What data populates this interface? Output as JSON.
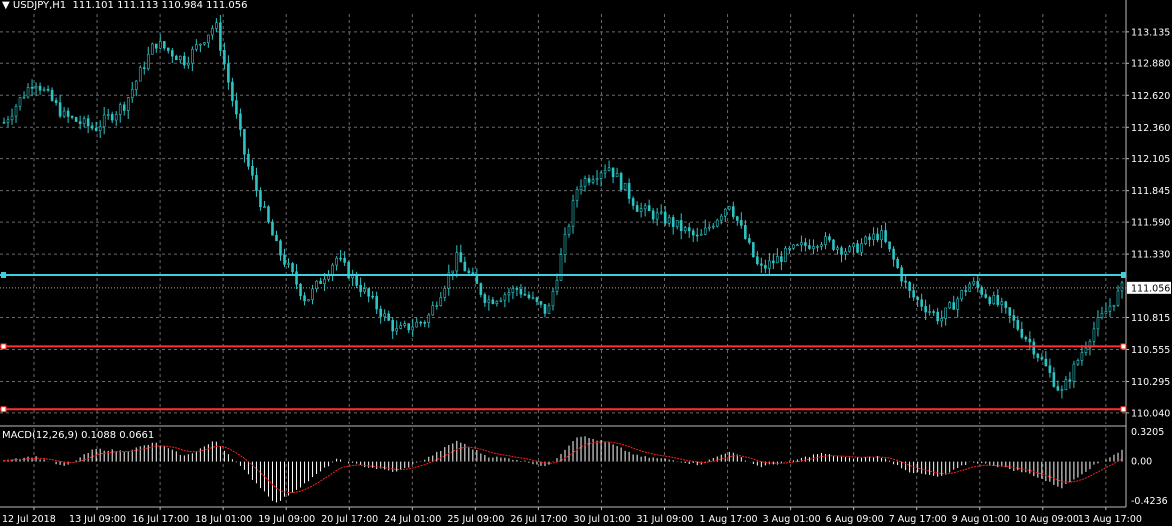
{
  "header": {
    "symbol": "USDJPY,H1",
    "ohlc": "111.101 111.113 110.984 111.056"
  },
  "indicator": {
    "label": "MACD(12,26,9) 0.1088 0.0661",
    "scale": [
      "0.3205",
      "0.00",
      "-0.4236"
    ]
  },
  "price_axis": {
    "ticks": [
      "113.135",
      "112.880",
      "112.620",
      "112.360",
      "112.105",
      "111.845",
      "111.590",
      "111.330",
      "110.815",
      "110.555",
      "110.295",
      "110.040"
    ],
    "current_price": "111.056"
  },
  "time_axis": {
    "labels": [
      "12 Jul 2018",
      "13 Jul 09:00",
      "16 Jul 17:00",
      "18 Jul 01:00",
      "19 Jul 09:00",
      "20 Jul 17:00",
      "24 Jul 01:00",
      "25 Jul 09:00",
      "26 Jul 17:00",
      "30 Jul 01:00",
      "31 Jul 09:00",
      "1 Aug 17:00",
      "3 Aug 01:00",
      "6 Aug 09:00",
      "7 Aug 17:00",
      "9 Aug 01:00",
      "10 Aug 09:00",
      "13 Aug 17:00"
    ]
  },
  "lines": {
    "cyan_level": 111.16,
    "red_levels": [
      110.58,
      110.07
    ]
  },
  "colors": {
    "background": "#000000",
    "grid": "#6b6b6b",
    "candles": "#2ec4c4",
    "cyan_line": "#3fd0e0",
    "red_line": "#ff3030",
    "macd_hist": "#ffffff",
    "macd_signal": "#ff2020",
    "text": "#ffffff"
  },
  "chart_data": {
    "type": "candlestick",
    "symbol": "USDJPY",
    "timeframe": "H1",
    "x": [
      "12 Jul 2018",
      "13 Jul 09:00",
      "16 Jul 17:00",
      "18 Jul 01:00",
      "19 Jul 09:00",
      "20 Jul 17:00",
      "24 Jul 01:00",
      "25 Jul 09:00",
      "26 Jul 17:00",
      "30 Jul 01:00",
      "31 Jul 09:00",
      "1 Aug 17:00",
      "3 Aug 01:00",
      "6 Aug 09:00",
      "7 Aug 17:00",
      "9 Aug 01:00",
      "10 Aug 09:00",
      "13 Aug 17:00"
    ],
    "close_path": [
      112.4,
      112.75,
      112.45,
      112.35,
      112.55,
      113.05,
      112.9,
      113.2,
      112.1,
      111.4,
      110.95,
      111.3,
      111.0,
      110.7,
      110.8,
      111.3,
      110.95,
      111.05,
      110.85,
      111.9,
      112.05,
      111.7,
      111.6,
      111.45,
      111.75,
      111.2,
      111.35,
      111.45,
      111.35,
      111.5,
      111.0,
      110.8,
      111.1,
      110.9,
      110.6,
      110.2,
      110.7,
      111.05
    ],
    "ylim": [
      109.95,
      113.28
    ],
    "yticks": [
      113.135,
      112.88,
      112.62,
      112.36,
      112.105,
      111.845,
      111.59,
      111.33,
      111.056,
      110.815,
      110.555,
      110.295,
      110.04
    ],
    "macd_path": [
      0.02,
      0.05,
      -0.05,
      0.12,
      0.1,
      0.18,
      0.05,
      0.2,
      -0.1,
      -0.4,
      -0.2,
      0.02,
      -0.05,
      -0.1,
      0.03,
      0.2,
      0.05,
      0.02,
      -0.05,
      0.25,
      0.18,
      0.05,
      0.02,
      -0.03,
      0.1,
      -0.05,
      0.0,
      0.08,
      0.03,
      0.05,
      -0.1,
      -0.15,
      0.0,
      -0.05,
      -0.12,
      -0.25,
      -0.05,
      0.11
    ],
    "macd_ylim": [
      -0.4236,
      0.3205
    ]
  }
}
